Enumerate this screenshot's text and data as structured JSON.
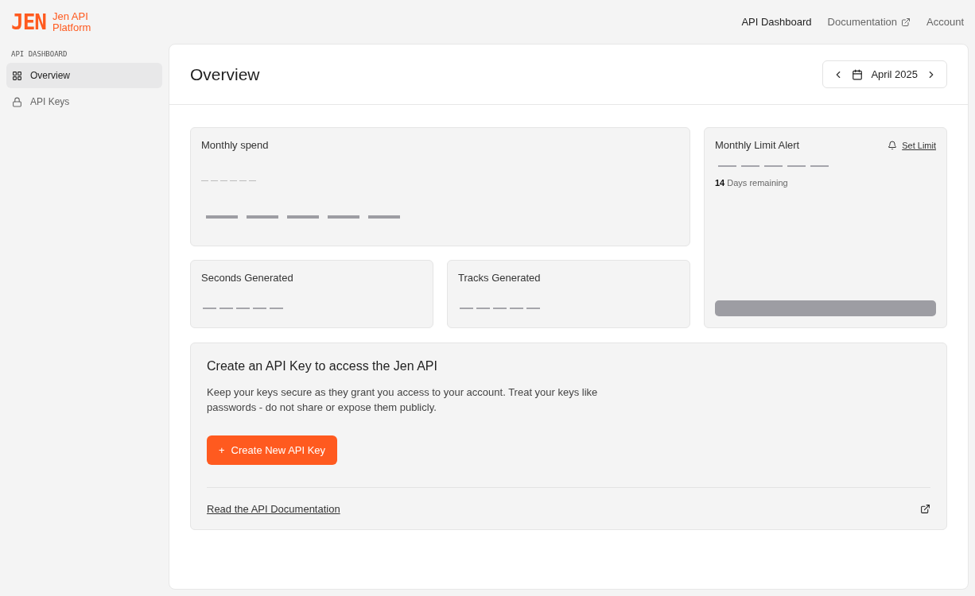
{
  "logo": {
    "mark": "JEN",
    "name": "Jen API Platform"
  },
  "top_nav": [
    {
      "label": "API Dashboard",
      "selected": true,
      "external": false
    },
    {
      "label": "Documentation",
      "selected": false,
      "external": true
    },
    {
      "label": "Account",
      "selected": false,
      "external": false
    }
  ],
  "sidebar": {
    "section": "API DASHBOARD",
    "items": [
      {
        "label": "Overview",
        "kind": "grid",
        "selected": true
      },
      {
        "label": "API Keys",
        "kind": "lock",
        "selected": false
      }
    ]
  },
  "page": {
    "title": "Overview",
    "month": "April 2025"
  },
  "cards": {
    "monthly_spend": {
      "title": "Monthly spend"
    },
    "seconds": {
      "title": "Seconds Generated"
    },
    "tracks": {
      "title": "Tracks Generated"
    },
    "limit": {
      "title": "Monthly Limit Alert",
      "action": "Set Limit",
      "remaining": "**14** Days remaining"
    }
  },
  "api_key_panel": {
    "title": "Create an API Key to access the Jen API",
    "text": "Keep your keys secure as they grant you access to your account. Treat your keys like passwords - do not share or expose them publicly.",
    "button_icon": "+",
    "button": "Create New API Key",
    "link": "Read the API Documentation"
  }
}
